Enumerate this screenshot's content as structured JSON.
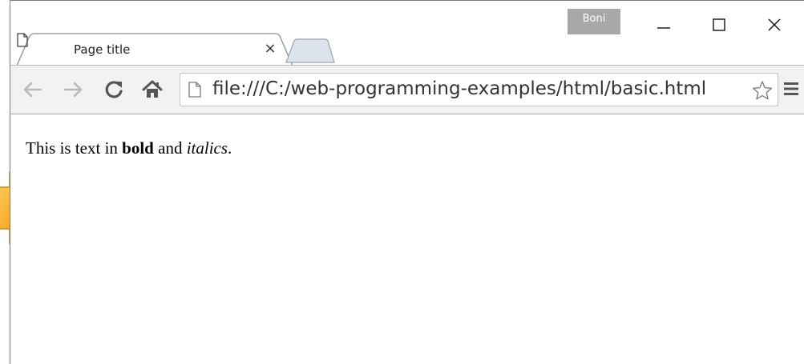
{
  "browser": {
    "tab": {
      "title": "Page title",
      "close_glyph": "×"
    },
    "profile": {
      "name": "Boni"
    },
    "window_controls": {
      "minimize_icon": "minimize-icon",
      "maximize_icon": "maximize-icon",
      "close_icon": "close-icon"
    },
    "toolbar": {
      "back_icon": "arrow-left-icon",
      "forward_icon": "arrow-right-icon",
      "reload_icon": "reload-icon",
      "home_icon": "home-icon",
      "url": "file:///C:/web-programming-examples/html/basic.html",
      "bookmark_icon": "star-icon",
      "menu_icon": "hamburger-menu-icon"
    }
  },
  "page": {
    "text_before": "This is text in ",
    "bold_word": "bold",
    "text_middle": " and ",
    "italic_word": "italics",
    "text_after": "."
  },
  "colors": {
    "toolbar_bg": "#f2f2f2",
    "profile_badge_bg": "#a8a8a8",
    "decoration_arrow": "#f5a623"
  }
}
